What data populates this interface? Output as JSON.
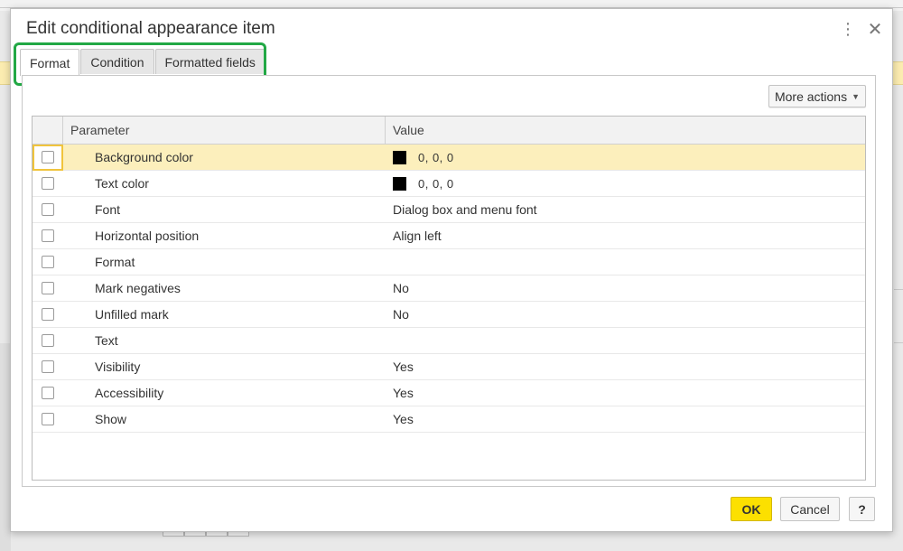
{
  "dialog": {
    "title": "Edit conditional appearance item",
    "kebab_glyph": "⋮",
    "close_glyph": "✕"
  },
  "tabs": [
    {
      "label": "Format",
      "active": true
    },
    {
      "label": "Condition",
      "active": false
    },
    {
      "label": "Formatted fields",
      "active": false
    }
  ],
  "toolbar": {
    "more_actions_label": "More actions",
    "more_actions_caret": "▼"
  },
  "table": {
    "columns": [
      "Parameter",
      "Value"
    ],
    "rows": [
      {
        "parameter": "Background color",
        "value": "0, 0, 0",
        "swatch": "#000000",
        "selected": true
      },
      {
        "parameter": "Text color",
        "value": "0, 0, 0",
        "swatch": "#000000"
      },
      {
        "parameter": "Font",
        "value": "Dialog box and menu font"
      },
      {
        "parameter": "Horizontal position",
        "value": "Align left"
      },
      {
        "parameter": "Format",
        "value": ""
      },
      {
        "parameter": "Mark negatives",
        "value": "No"
      },
      {
        "parameter": "Unfilled mark",
        "value": "No"
      },
      {
        "parameter": "Text",
        "value": ""
      },
      {
        "parameter": "Visibility",
        "value": "Yes"
      },
      {
        "parameter": "Accessibility",
        "value": "Yes"
      },
      {
        "parameter": "Show",
        "value": "Yes"
      }
    ]
  },
  "footer": {
    "ok_label": "OK",
    "cancel_label": "Cancel",
    "help_label": "?"
  },
  "colors": {
    "accent_ok": "#fce000",
    "selected_row": "#fcefbc",
    "highlight_outline": "#22a845"
  }
}
